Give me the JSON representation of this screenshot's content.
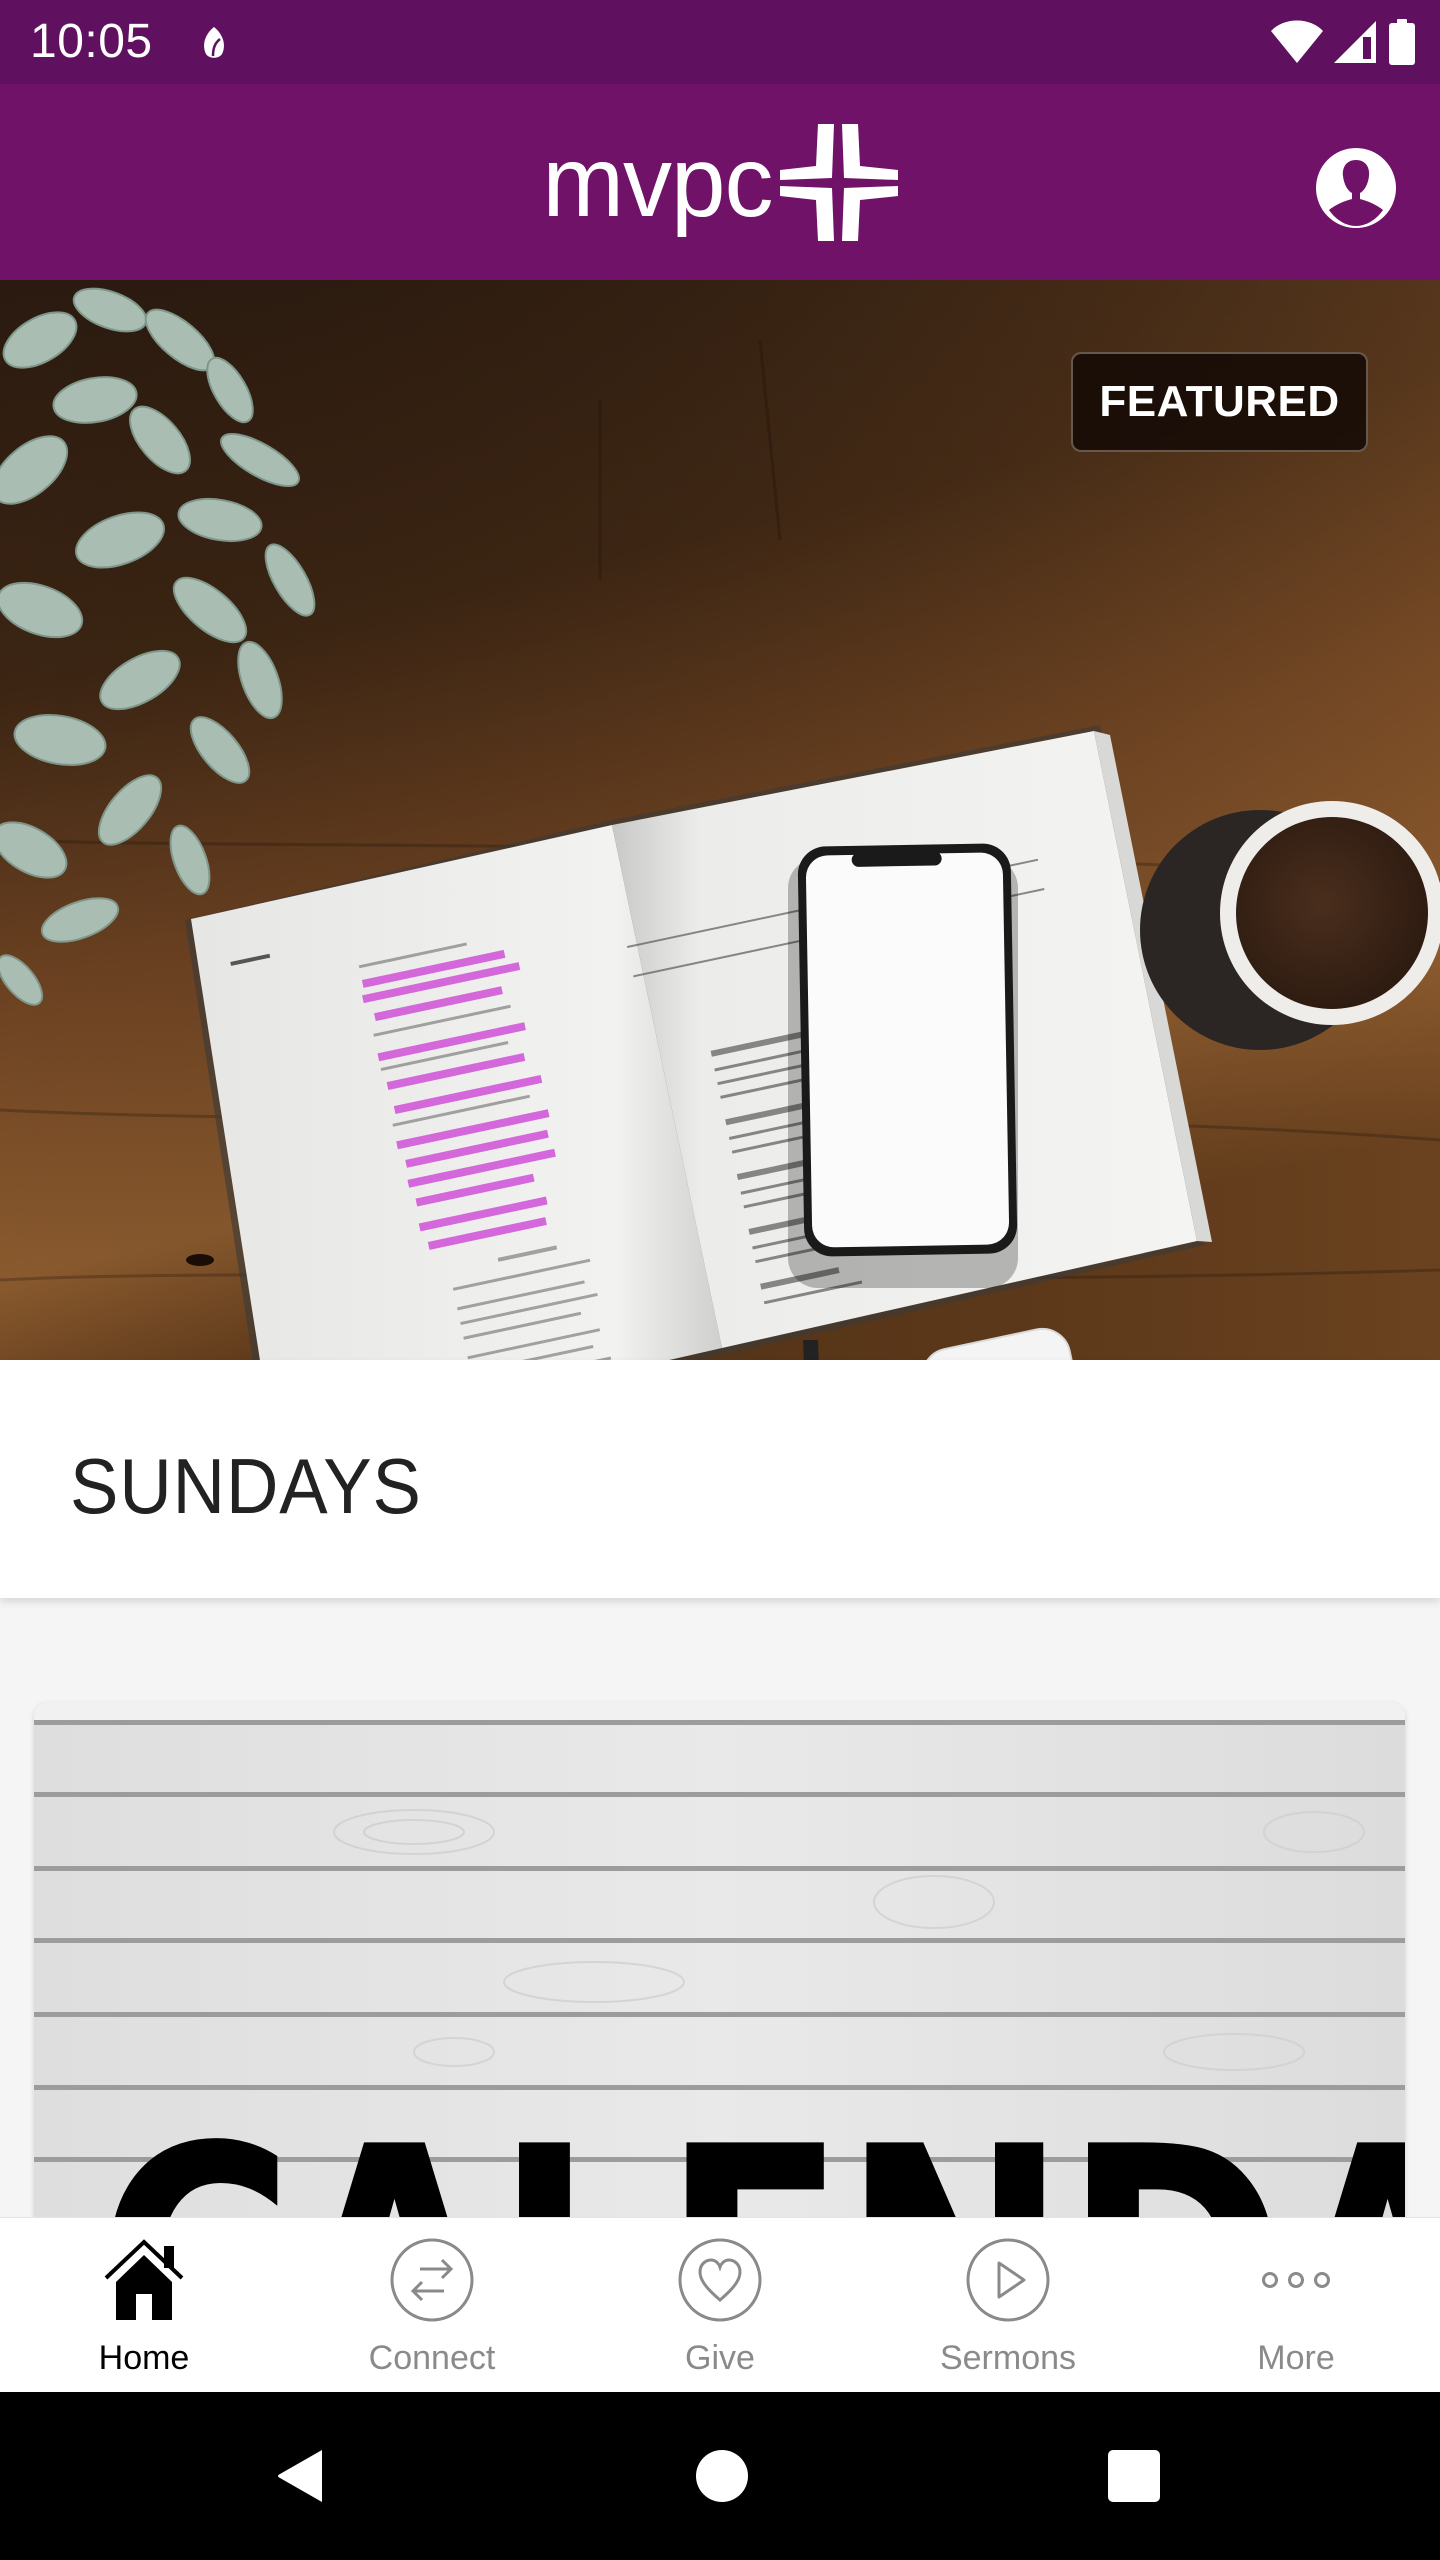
{
  "status_bar": {
    "time": "10:05",
    "icons": [
      "leaf-notification-icon",
      "wifi-icon",
      "cellular-signal-icon",
      "battery-icon"
    ]
  },
  "header": {
    "logo_text": "mvpc",
    "logo_icon": "cross-icon",
    "profile_icon": "profile-icon",
    "background_color": "#701268",
    "status_bar_color": "#5f1160"
  },
  "hero": {
    "badge": "FEATURED",
    "image_description": "open bible with highlighted verses, smartphone, coffee mug, earbuds and plant on wooden table"
  },
  "section": {
    "title": "SUNDAYS"
  },
  "card": {
    "title": "CALENDAR",
    "image_description": "white wood planks background"
  },
  "tabs": [
    {
      "label": "Home",
      "icon": "home-icon",
      "active": true
    },
    {
      "label": "Connect",
      "icon": "connect-arrows-icon",
      "active": false
    },
    {
      "label": "Give",
      "icon": "heart-icon",
      "active": false
    },
    {
      "label": "Sermons",
      "icon": "play-icon",
      "active": false
    },
    {
      "label": "More",
      "icon": "more-dots-icon",
      "active": false
    }
  ],
  "colors": {
    "tab_active": "#000000",
    "tab_inactive": "#8a8a8a"
  },
  "system_nav": {
    "buttons": [
      "back-icon",
      "home-circle-icon",
      "recents-icon"
    ]
  }
}
